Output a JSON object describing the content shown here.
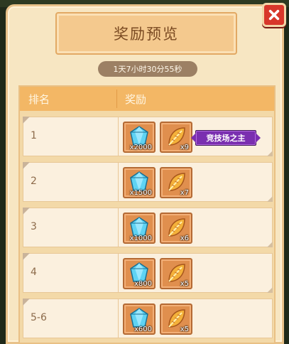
{
  "title": "奖励预览",
  "timer": "1天7小时30分55秒",
  "header": {
    "rank": "排名",
    "reward": "奖励"
  },
  "rows": [
    {
      "rank": "1",
      "gem_qty": "x2000",
      "leaf_qty": "x9",
      "badge": "竞技场之主"
    },
    {
      "rank": "2",
      "gem_qty": "x1500",
      "leaf_qty": "x7"
    },
    {
      "rank": "3",
      "gem_qty": "x1000",
      "leaf_qty": "x6"
    },
    {
      "rank": "4",
      "gem_qty": "x800",
      "leaf_qty": "x5"
    },
    {
      "rank": "5-6",
      "gem_qty": "x600",
      "leaf_qty": "x5"
    }
  ],
  "icons": {
    "close": "close-icon",
    "gem": "diamond-gem-icon",
    "leaf": "golden-leaf-icon"
  },
  "colors": {
    "panel": "#f7e6c2",
    "header": "#f3b765",
    "close": "#d8372b",
    "badge": "#7a2fb0"
  }
}
